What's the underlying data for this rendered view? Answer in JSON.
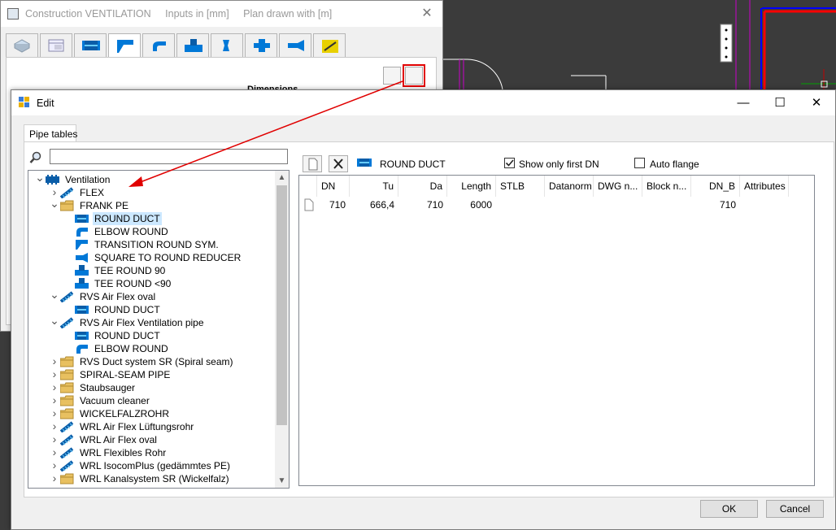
{
  "construction_window": {
    "title_parts": [
      "Construction VENTILATION",
      "Inputs in [mm]",
      "Plan drawn with  [m]"
    ],
    "close_glyph": "✕",
    "section_label": "Dimensions",
    "tab_icons": [
      "box-icon",
      "table-icon",
      "round-duct-icon",
      "transition-icon",
      "elbow-icon",
      "tee-icon",
      "reducer-icon",
      "cross-icon",
      "saddle-icon",
      "flex-icon"
    ]
  },
  "edit_dialog": {
    "title": "Edit",
    "window_controls": {
      "minimize": "—",
      "maximize": "☐",
      "close": "✕"
    },
    "tab_label": "Pipe tables",
    "search": {
      "value": "",
      "placeholder": ""
    },
    "tree": [
      {
        "label": "Ventilation",
        "level": 0,
        "expanded": true,
        "icon": "ventilation-icon"
      },
      {
        "label": "FLEX",
        "level": 1,
        "expanded": false,
        "icon": "flex-pipe-icon"
      },
      {
        "label": "FRANK PE",
        "level": 1,
        "expanded": true,
        "icon": "folder-icon"
      },
      {
        "label": "ROUND DUCT",
        "level": 2,
        "icon": "round-duct-icon",
        "selected": true
      },
      {
        "label": "ELBOW ROUND",
        "level": 2,
        "icon": "elbow-icon"
      },
      {
        "label": "TRANSITION ROUND SYM.",
        "level": 2,
        "icon": "transition-icon"
      },
      {
        "label": "SQUARE TO ROUND REDUCER",
        "level": 2,
        "icon": "reducer-icon"
      },
      {
        "label": "TEE ROUND 90",
        "level": 2,
        "icon": "tee-icon"
      },
      {
        "label": "TEE ROUND <90",
        "level": 2,
        "icon": "tee-icon"
      },
      {
        "label": "RVS Air Flex oval",
        "level": 1,
        "expanded": true,
        "icon": "flex-pipe-icon"
      },
      {
        "label": "ROUND DUCT",
        "level": 2,
        "icon": "round-duct-icon"
      },
      {
        "label": "RVS Air Flex Ventilation pipe",
        "level": 1,
        "expanded": true,
        "icon": "flex-pipe-icon"
      },
      {
        "label": "ROUND DUCT",
        "level": 2,
        "icon": "round-duct-icon"
      },
      {
        "label": "ELBOW ROUND",
        "level": 2,
        "icon": "elbow-icon"
      },
      {
        "label": "RVS Duct system SR (Spiral seam)",
        "level": 1,
        "expanded": false,
        "icon": "folder-icon"
      },
      {
        "label": "SPIRAL-SEAM PIPE",
        "level": 1,
        "expanded": false,
        "icon": "folder-icon"
      },
      {
        "label": "Staubsauger",
        "level": 1,
        "expanded": false,
        "icon": "folder-icon"
      },
      {
        "label": "Vacuum cleaner",
        "level": 1,
        "expanded": false,
        "icon": "folder-icon"
      },
      {
        "label": "WICKELFALZROHR",
        "level": 1,
        "expanded": false,
        "icon": "folder-icon"
      },
      {
        "label": "WRL Air Flex Lüftungsrohr",
        "level": 1,
        "expanded": false,
        "icon": "flex-pipe-icon"
      },
      {
        "label": "WRL Air Flex oval",
        "level": 1,
        "expanded": false,
        "icon": "flex-pipe-icon"
      },
      {
        "label": "WRL Flexibles Rohr",
        "level": 1,
        "expanded": false,
        "icon": "flex-pipe-icon"
      },
      {
        "label": "WRL IsocomPlus (gedämmtes PE)",
        "level": 1,
        "expanded": false,
        "icon": "flex-pipe-icon"
      },
      {
        "label": "WRL Kanalsystem SR (Wickelfalz)",
        "level": 1,
        "expanded": false,
        "icon": "folder-icon"
      }
    ],
    "right_panel": {
      "selected_name": "ROUND DUCT",
      "show_only_first_dn": {
        "label": "Show only first DN",
        "checked": true
      },
      "auto_flange": {
        "label": "Auto flange",
        "checked": false
      },
      "columns": [
        "DN",
        "Tu",
        "Da",
        "Length",
        "STLB",
        "Datanorm",
        "DWG n...",
        "Block n...",
        "DN_B",
        "Attributes"
      ],
      "rows": [
        {
          "DN": "710",
          "Tu": "666,4",
          "Da": "710",
          "Length": "6000",
          "STLB": "",
          "Datanorm": "",
          "DWG": "",
          "Block": "",
          "DN_B": "710",
          "Attributes": ""
        }
      ]
    },
    "buttons": {
      "ok": "OK",
      "cancel": "Cancel"
    }
  },
  "colors": {
    "annotation_red": "#e00000",
    "selection": "#cce8ff",
    "cad_background": "#3b3b3b",
    "cad_magenta": "#c800c8",
    "cad_red": "#ff0000",
    "cad_blue": "#0000ff",
    "duct_blue": "#0078d7"
  }
}
